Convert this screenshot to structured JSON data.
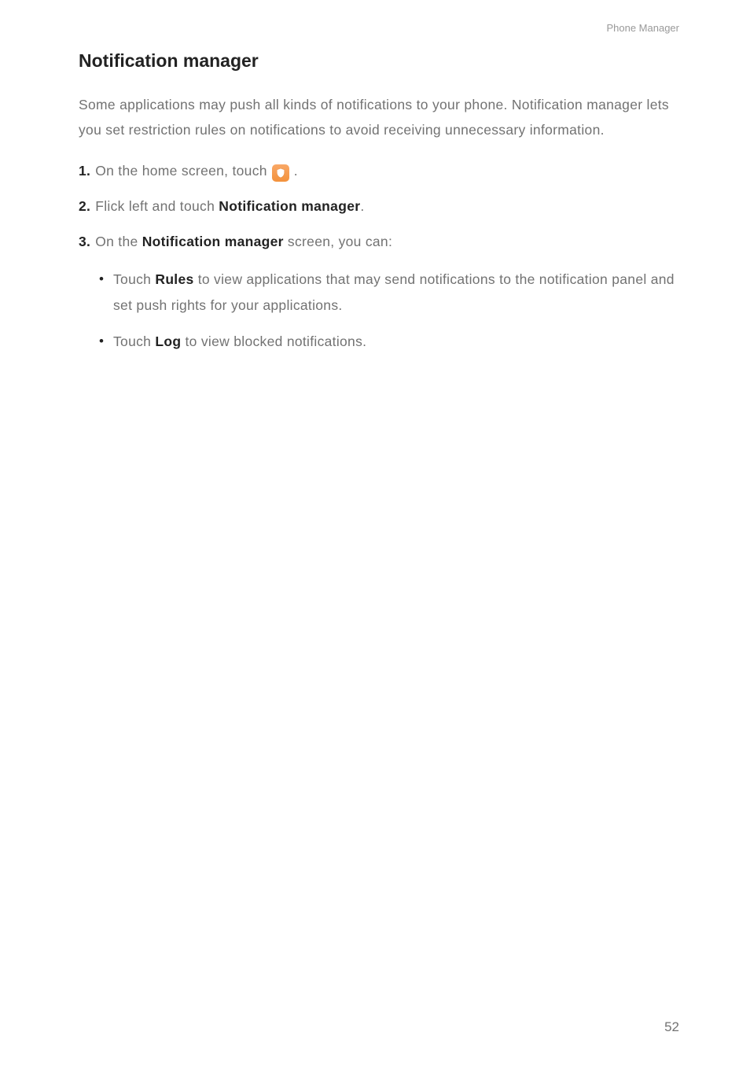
{
  "header": {
    "running": "Phone Manager"
  },
  "section": {
    "title": "Notification  manager",
    "intro": "Some applications may push all kinds of notifications to your phone. Notification manager lets you set restriction rules on notifications to avoid receiving unnecessary information."
  },
  "steps": {
    "s1": {
      "num": "1.",
      "before": "On the home screen, touch",
      "after": "."
    },
    "s2": {
      "num": "2.",
      "before": "Flick left and touch ",
      "bold": "Notification manager",
      "after": "."
    },
    "s3": {
      "num": "3.",
      "before": "On the ",
      "bold": "Notification manager",
      "after": " screen, you can:"
    }
  },
  "bullets": {
    "b1": {
      "pre": "Touch ",
      "bold": "Rules",
      "post": " to view applications that may send notifications to the notification panel and set push rights for your applications."
    },
    "b2": {
      "pre": "Touch ",
      "bold": "Log",
      "post": " to view blocked notifications."
    }
  },
  "page_number": "52"
}
